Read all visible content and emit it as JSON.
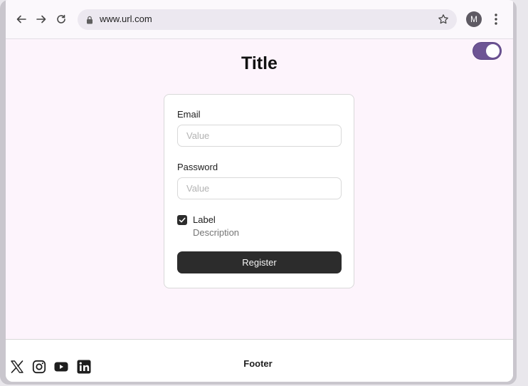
{
  "browser": {
    "url": "www.url.com",
    "avatar_initial": "M",
    "icons": [
      "back-arrow-icon",
      "forward-arrow-icon",
      "reload-icon",
      "lock-icon",
      "star-icon",
      "more-vertical-icon"
    ]
  },
  "page": {
    "title": "Title",
    "theme_toggle_on": true,
    "accent_color": "#6d5494",
    "background_color": "#fdf4fc"
  },
  "form": {
    "email_label": "Email",
    "email_placeholder": "Value",
    "password_label": "Password",
    "password_placeholder": "Value",
    "checkbox_checked": true,
    "checkbox_label": "Label",
    "checkbox_description": "Description",
    "register_label": "Register"
  },
  "footer": {
    "text": "Footer",
    "social_icons": [
      "x-icon",
      "instagram-icon",
      "youtube-icon",
      "linkedin-icon"
    ]
  }
}
